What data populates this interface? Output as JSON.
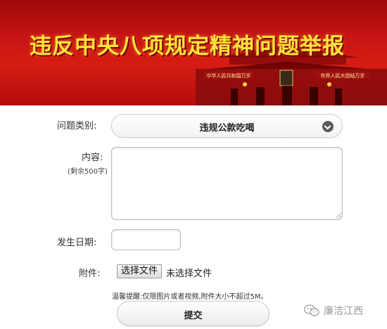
{
  "banner": {
    "title": "违反中央八项规定精神问题举报",
    "gate_slogan_left": "中华人民共和国万岁",
    "gate_slogan_right": "世界人民大团结万岁"
  },
  "form": {
    "category_label": "问题类别:",
    "category_value": "违规公款吃喝",
    "content_label": "内容:",
    "content_remaining": "(剩余500字)",
    "content_value": "",
    "date_label": "发生日期:",
    "date_value": "",
    "attachment_label": "附件:",
    "file_button_label": "选择文件",
    "file_status": "未选择文件",
    "tip": "温馨提醒:仅限图片或者视频,附件大小不超过5M。",
    "submit_label": "提交"
  },
  "watermark": {
    "text": "廉洁江西",
    "icon": "wechat-icon"
  },
  "colors": {
    "banner_red": "#c81414",
    "title_yellow": "#ffe23a"
  }
}
